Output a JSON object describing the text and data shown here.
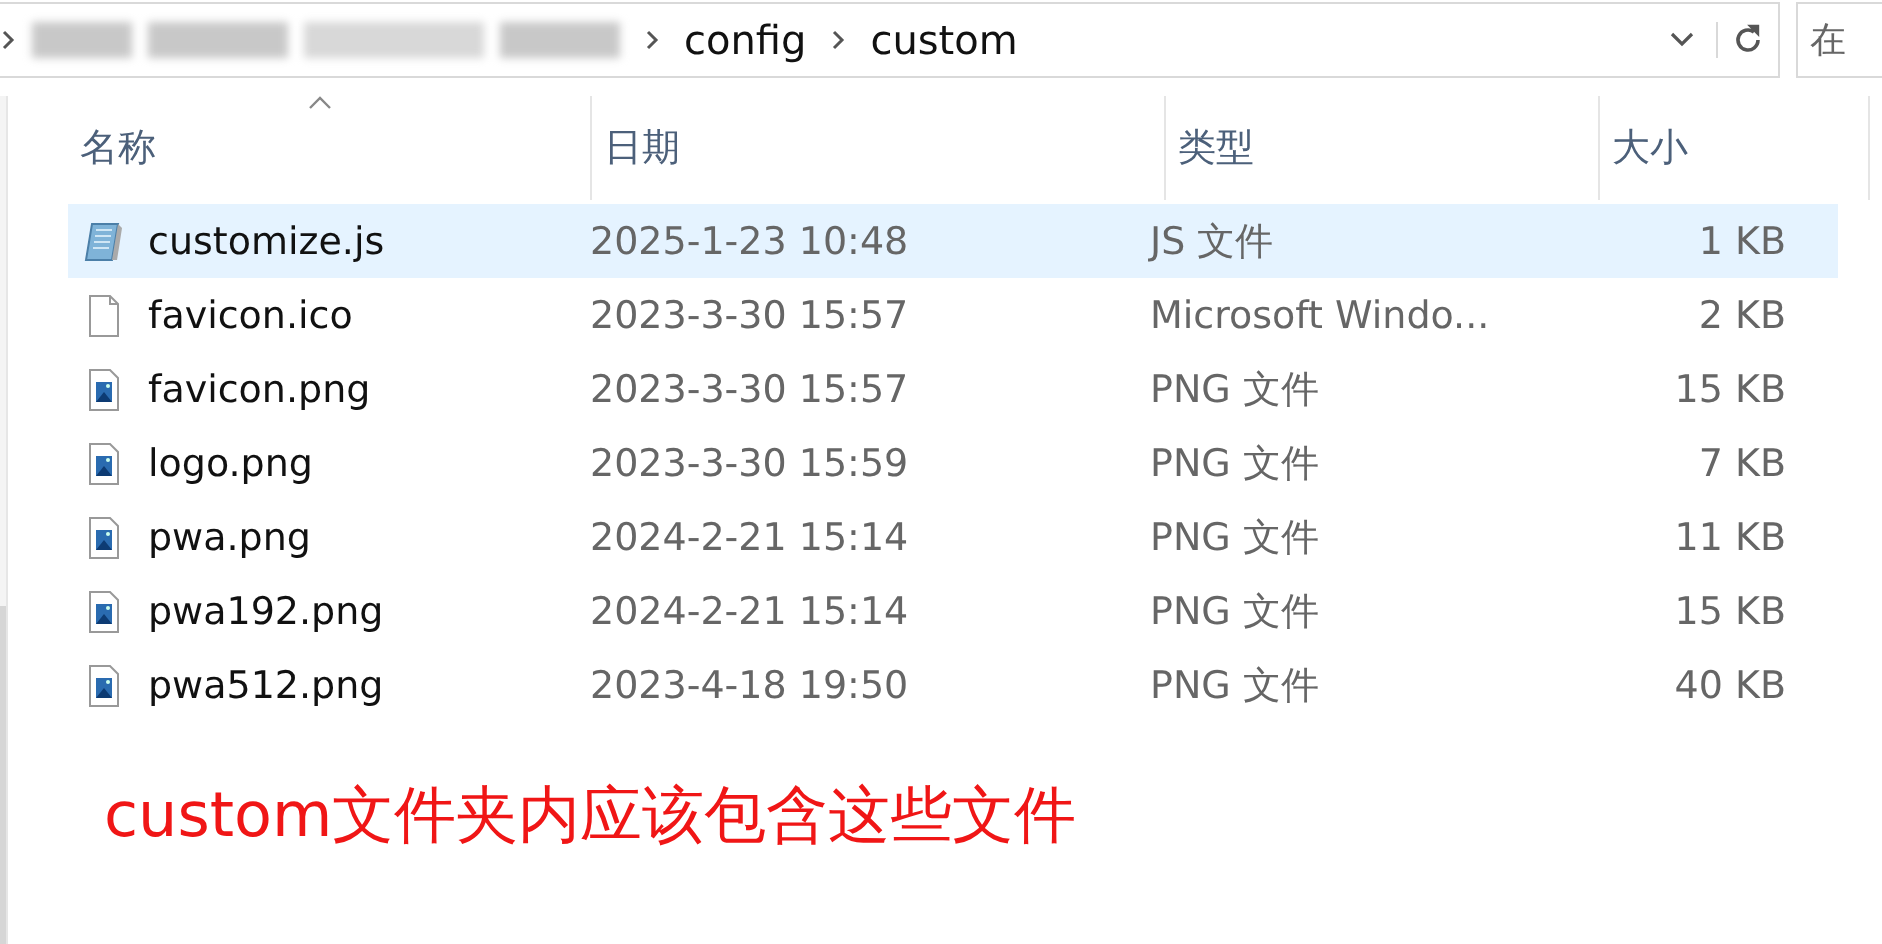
{
  "address_bar": {
    "segments": [
      "config",
      "custom"
    ]
  },
  "search": {
    "placeholder": "在"
  },
  "columns": [
    {
      "label": "名称",
      "sorted": true
    },
    {
      "label": "日期",
      "sorted": false
    },
    {
      "label": "类型",
      "sorted": false
    },
    {
      "label": "大小",
      "sorted": false
    }
  ],
  "rows": [
    {
      "name": "customize.js",
      "date": "2025-1-23 10:48",
      "type": "JS 文件",
      "size": "1 KB",
      "kind": "script",
      "selected": true
    },
    {
      "name": "favicon.ico",
      "date": "2023-3-30 15:57",
      "type": "Microsoft Windo...",
      "size": "2 KB",
      "kind": "blank",
      "selected": false
    },
    {
      "name": "favicon.png",
      "date": "2023-3-30 15:57",
      "type": "PNG 文件",
      "size": "15 KB",
      "kind": "image",
      "selected": false
    },
    {
      "name": "logo.png",
      "date": "2023-3-30 15:59",
      "type": "PNG 文件",
      "size": "7 KB",
      "kind": "image",
      "selected": false
    },
    {
      "name": "pwa.png",
      "date": "2024-2-21 15:14",
      "type": "PNG 文件",
      "size": "11 KB",
      "kind": "image",
      "selected": false
    },
    {
      "name": "pwa192.png",
      "date": "2024-2-21 15:14",
      "type": "PNG 文件",
      "size": "15 KB",
      "kind": "image",
      "selected": false
    },
    {
      "name": "pwa512.png",
      "date": "2023-4-18 19:50",
      "type": "PNG 文件",
      "size": "40 KB",
      "kind": "image",
      "selected": false
    }
  ],
  "annotation": "custom文件夹内应该包含这些文件"
}
